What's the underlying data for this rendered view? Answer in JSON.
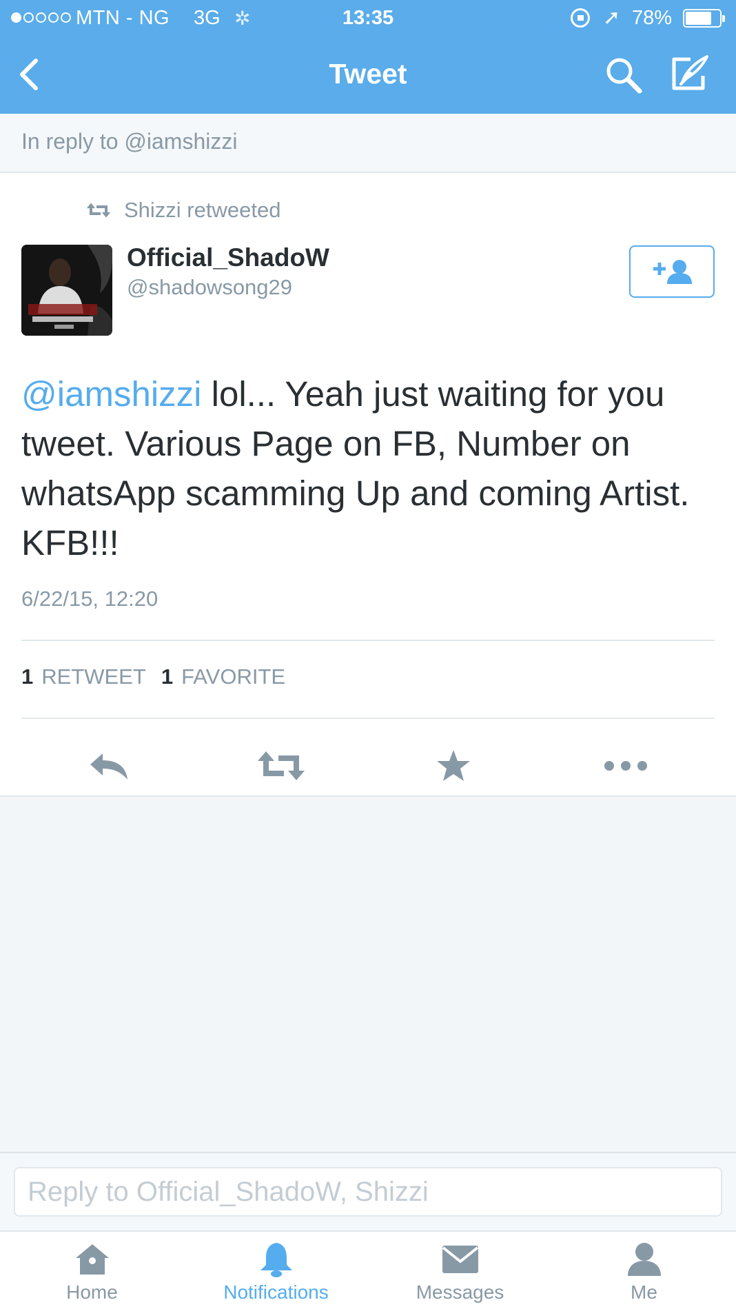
{
  "status_bar": {
    "carrier": "MTN - NG",
    "network": "3G",
    "time": "13:35",
    "battery_percent": "78%"
  },
  "nav": {
    "title": "Tweet",
    "back_icon": "chevron-left-icon",
    "search_icon": "search-icon",
    "compose_icon": "compose-icon"
  },
  "reply_context": "In reply to @iamshizzi",
  "tweet": {
    "retweeted_by": "Shizzi retweeted",
    "display_name": "Official_ShadoW",
    "handle": "@shadowsong29",
    "mention": "@iamshizzi",
    "text": " lol... Yeah just waiting for you tweet. Various Page on FB, Number on whatsApp scamming Up and coming Artist. KFB!!!",
    "timestamp": "6/22/15, 12:20",
    "retweet_count": "1",
    "retweet_label": "RETWEET",
    "favorite_count": "1",
    "favorite_label": "FAVORITE"
  },
  "reply_box": {
    "placeholder": "Reply to Official_ShadoW, Shizzi"
  },
  "tabs": [
    {
      "label": "Home",
      "icon": "home-icon"
    },
    {
      "label": "Notifications",
      "icon": "bell-icon"
    },
    {
      "label": "Messages",
      "icon": "envelope-icon"
    },
    {
      "label": "Me",
      "icon": "person-icon"
    }
  ],
  "colors": {
    "header": "#5aacea",
    "accent": "#55acee",
    "muted": "#8899a6",
    "text": "#292f33"
  }
}
